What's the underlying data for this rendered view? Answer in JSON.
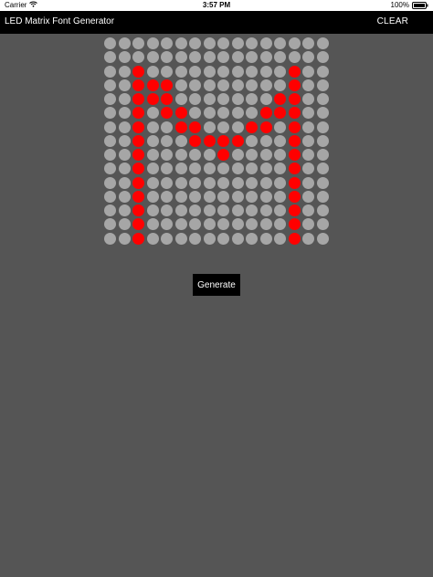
{
  "status_bar": {
    "carrier": "Carrier",
    "time": "3:57 PM",
    "battery": "100%"
  },
  "nav": {
    "title": "LED Matrix Font Generator",
    "clear_label": "CLEAR"
  },
  "matrix": {
    "columns": 16,
    "rows": 15,
    "on_color": "#ff0000",
    "off_color": "#a6a6a6",
    "cells": [
      "0000000000000000",
      "0000000000000000",
      "0010000000000100",
      "0011100000000100",
      "0011100000001100",
      "0010110000011100",
      "0010011000110100",
      "0010001111000100",
      "0010000010000100",
      "0010000000000100",
      "0010000000000100",
      "0010000000000100",
      "0010000000000100",
      "0010000000000100",
      "0010000000000100"
    ]
  },
  "generate_label": "Generate",
  "icons": {
    "wifi": "wifi-icon",
    "battery": "battery-icon"
  }
}
